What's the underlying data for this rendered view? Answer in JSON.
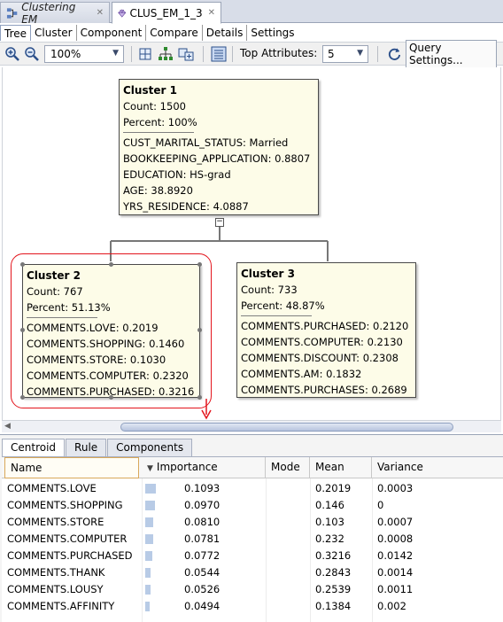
{
  "doc_tabs": [
    {
      "label": "Clustering EM",
      "active": false
    },
    {
      "label": "CLUS_EM_1_3",
      "active": true
    }
  ],
  "sub_tabs": [
    "Tree",
    "Cluster",
    "Component",
    "Compare",
    "Details",
    "Settings"
  ],
  "toolbar": {
    "zoom_value": "100%",
    "top_attributes_label": "Top Attributes:",
    "top_attributes_value": "5",
    "query_settings_label": "Query Settings..."
  },
  "tree": {
    "root": {
      "title": "Cluster 1",
      "count": "Count: 1500",
      "percent": "Percent: 100%",
      "attributes": [
        "CUST_MARITAL_STATUS: Married",
        "BOOKKEEPING_APPLICATION: 0.8807",
        "EDUCATION: HS-grad",
        "AGE: 38.8920",
        "YRS_RESIDENCE: 4.0887"
      ]
    },
    "left": {
      "title": "Cluster 2",
      "count": "Count: 767",
      "percent": "Percent: 51.13%",
      "attributes": [
        "COMMENTS.LOVE: 0.2019",
        "COMMENTS.SHOPPING: 0.1460",
        "COMMENTS.STORE: 0.1030",
        "COMMENTS.COMPUTER: 0.2320",
        "COMMENTS.PURCHASED: 0.3216"
      ]
    },
    "right": {
      "title": "Cluster 3",
      "count": "Count: 733",
      "percent": "Percent: 48.87%",
      "attributes": [
        "COMMENTS.PURCHASED: 0.2120",
        "COMMENTS.COMPUTER: 0.2130",
        "COMMENTS.DISCOUNT: 0.2308",
        "COMMENTS.AM: 0.1832",
        "COMMENTS.PURCHASES: 0.2689"
      ]
    }
  },
  "panel_tabs": [
    "Centroid",
    "Rule",
    "Components"
  ],
  "grid": {
    "columns": [
      "Name",
      "Importance",
      "Mode",
      "Mean",
      "Variance"
    ],
    "max_importance": 0.1093,
    "rows": [
      {
        "name": "COMMENTS.LOVE",
        "importance": "0.1093",
        "mode": "",
        "mean": "0.2019",
        "variance": "0.0003"
      },
      {
        "name": "COMMENTS.SHOPPING",
        "importance": "0.0970",
        "mode": "",
        "mean": "0.146",
        "variance": "0"
      },
      {
        "name": "COMMENTS.STORE",
        "importance": "0.0810",
        "mode": "",
        "mean": "0.103",
        "variance": "0.0007"
      },
      {
        "name": "COMMENTS.COMPUTER",
        "importance": "0.0781",
        "mode": "",
        "mean": "0.232",
        "variance": "0.0008"
      },
      {
        "name": "COMMENTS.PURCHASED",
        "importance": "0.0772",
        "mode": "",
        "mean": "0.3216",
        "variance": "0.0142"
      },
      {
        "name": "COMMENTS.THANK",
        "importance": "0.0544",
        "mode": "",
        "mean": "0.2843",
        "variance": "0.0014"
      },
      {
        "name": "COMMENTS.LOUSY",
        "importance": "0.0526",
        "mode": "",
        "mean": "0.2539",
        "variance": "0.0011"
      },
      {
        "name": "COMMENTS.AFFINITY",
        "importance": "0.0494",
        "mode": "",
        "mean": "0.1384",
        "variance": "0.002"
      }
    ]
  },
  "colors": {
    "highlight": "#e3141c",
    "node_fill": "#fdfce8",
    "importance_bar": "#b8cbe6"
  }
}
